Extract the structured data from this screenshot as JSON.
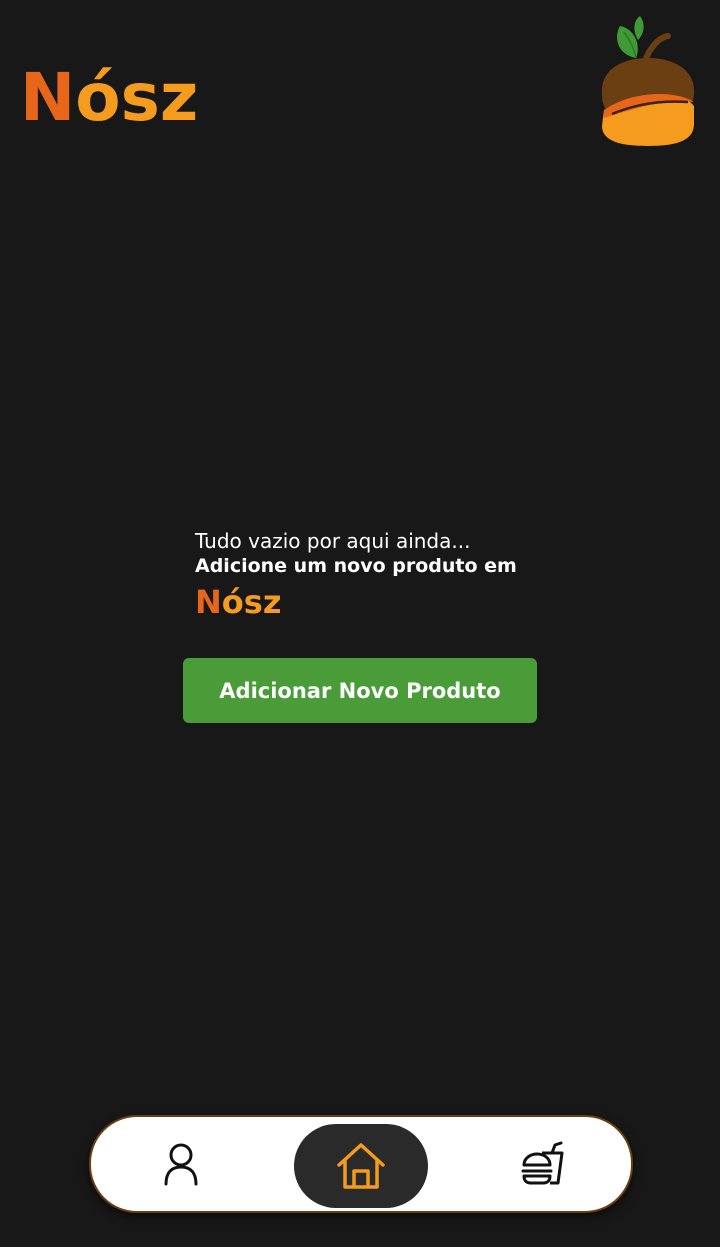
{
  "header": {
    "brand_initial": "N",
    "brand_rest": "ósz"
  },
  "empty_state": {
    "line1": "Tudo vazio por aqui ainda...",
    "line2": "Adicione um novo produto em",
    "brand_initial": "N",
    "brand_rest": "ósz"
  },
  "actions": {
    "add_product_label": "Adicionar Novo Produto"
  },
  "bottom_nav": {
    "items": [
      {
        "icon": "user-icon",
        "active": false
      },
      {
        "icon": "home-icon",
        "active": true
      },
      {
        "icon": "food-icon",
        "active": false
      }
    ]
  },
  "colors": {
    "background": "#181818",
    "brand_orange_dark": "#e8661a",
    "brand_orange": "#f59b1d",
    "button_green": "#4a9c38",
    "nav_active_bg": "#2a2a2b",
    "nav_border": "#6b3f12",
    "acorn_cap": "#6b3f12",
    "leaf_green": "#3f9a35"
  }
}
